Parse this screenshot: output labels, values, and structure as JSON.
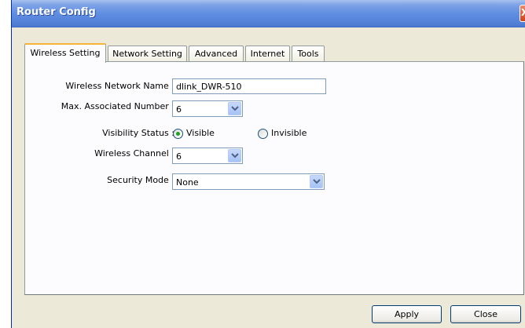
{
  "window": {
    "title": "Router Config",
    "close_glyph": "X"
  },
  "tabs": [
    {
      "label": "Wireless Setting"
    },
    {
      "label": "Network Setting"
    },
    {
      "label": "Advanced"
    },
    {
      "label": "Internet"
    },
    {
      "label": "Tools"
    }
  ],
  "form": {
    "network_name": {
      "label": "Wireless Network Name :",
      "value": "dlink_DWR-510"
    },
    "max_assoc": {
      "label": "Max. Associated Number :",
      "value": "6"
    },
    "visibility": {
      "label": "Visibility Status :",
      "opt_visible": "Visible",
      "opt_invisible": "Invisible",
      "selected": "Visible"
    },
    "channel": {
      "label": "Wireless Channel :",
      "value": "6"
    },
    "security": {
      "label": "Security Mode :",
      "value": "None"
    }
  },
  "buttons": {
    "apply": "Apply",
    "close": "Close"
  },
  "colors": {
    "titlebar": "#5f8ee2",
    "panel": "#fcfcfe",
    "window_bg": "#ece9d8",
    "active_tab_accent": "#f5b53b",
    "radio_dot": "#21a121"
  }
}
